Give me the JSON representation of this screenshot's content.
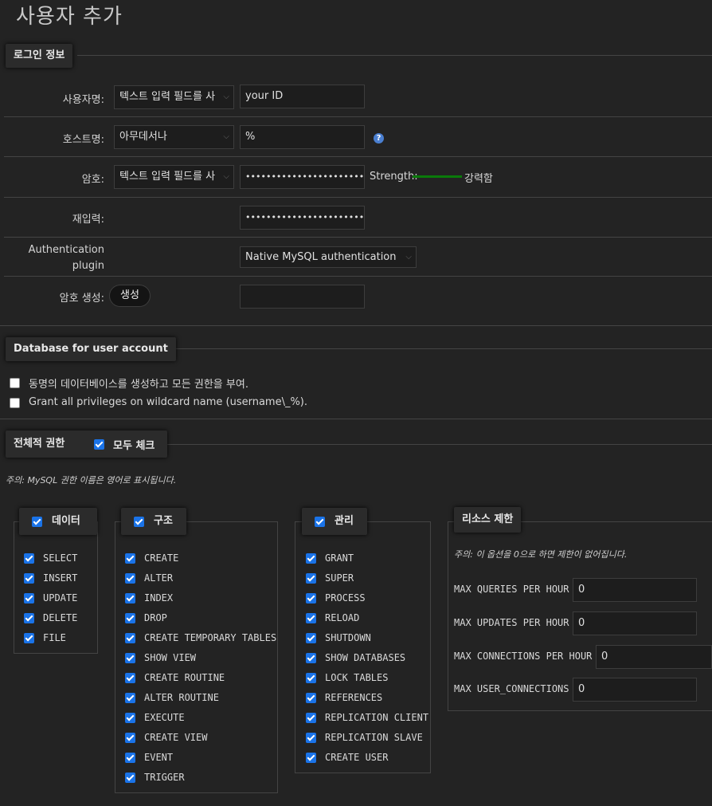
{
  "page": {
    "title": "사용자 추가"
  },
  "login": {
    "legend": "로그인 정보",
    "username": {
      "label": "사용자명:",
      "select": "텍스트 입력 필드를 사",
      "value": "your ID"
    },
    "host": {
      "label": "호스트명:",
      "select": "아무데서나",
      "value": "%",
      "help_icon": "help-icon"
    },
    "password": {
      "label": "암호:",
      "select": "텍스트 입력 필드를 사",
      "value": "••••••••••••••••••••••••",
      "strength_label": "Strength:",
      "strength_text": "강력함",
      "strength_color": "#0a7a0a"
    },
    "reenter": {
      "label": "재입력:",
      "value": "••••••••••••••••••••••••"
    },
    "auth_plugin": {
      "label_line1": "Authentication",
      "label_line2": "plugin",
      "select": "Native MySQL authentication"
    },
    "generate": {
      "label": "암호 생성:",
      "button": "생성",
      "value": ""
    }
  },
  "database": {
    "legend": "Database for user account",
    "options": [
      {
        "label": "동명의 데이터베이스를 생성하고 모든 권한을 부여.",
        "checked": false
      },
      {
        "label": "Grant all privileges on wildcard name (username\\_%).",
        "checked": false
      }
    ]
  },
  "global_privs": {
    "legend": "전체적 권한",
    "check_all": "모두 체크",
    "note": "주의: MySQL 권한 이름은 영어로 표시됩니다.",
    "groups": {
      "data": {
        "title": "데이터",
        "items": [
          "SELECT",
          "INSERT",
          "UPDATE",
          "DELETE",
          "FILE"
        ]
      },
      "structure": {
        "title": "구조",
        "items": [
          "CREATE",
          "ALTER",
          "INDEX",
          "DROP",
          "CREATE TEMPORARY TABLES",
          "SHOW VIEW",
          "CREATE ROUTINE",
          "ALTER ROUTINE",
          "EXECUTE",
          "CREATE VIEW",
          "EVENT",
          "TRIGGER"
        ]
      },
      "admin": {
        "title": "관리",
        "items": [
          "GRANT",
          "SUPER",
          "PROCESS",
          "RELOAD",
          "SHUTDOWN",
          "SHOW DATABASES",
          "LOCK TABLES",
          "REFERENCES",
          "REPLICATION CLIENT",
          "REPLICATION SLAVE",
          "CREATE USER"
        ]
      },
      "resource": {
        "title": "리소스 제한",
        "note": "주의: 이 옵션을 0으로 하면 제한이 없어집니다.",
        "fields": [
          {
            "label": "MAX QUERIES PER HOUR",
            "value": "0"
          },
          {
            "label": "MAX UPDATES PER HOUR",
            "value": "0"
          },
          {
            "label": "MAX CONNECTIONS PER HOUR",
            "value": "0"
          },
          {
            "label": "MAX USER_CONNECTIONS",
            "value": "0"
          }
        ]
      }
    }
  },
  "colors": {
    "checkbox_accent": "#1a73e8",
    "background": "#232323"
  }
}
